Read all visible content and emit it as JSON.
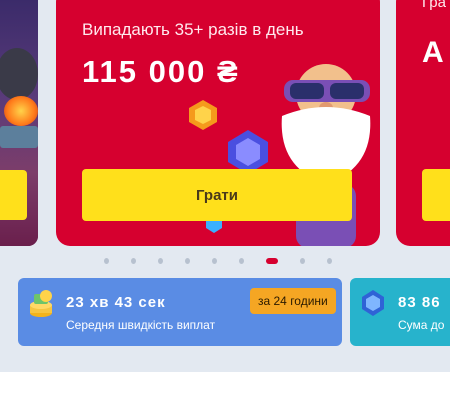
{
  "carousel": {
    "main_card": {
      "subtitle": "Випадають 35+ разів в день",
      "amount": "115 000 ₴",
      "play_label": "Грати"
    },
    "right_card": {
      "peek_top": "Гра",
      "peek_big": "A"
    },
    "dots_count": 9,
    "active_dot": 6
  },
  "stats": [
    {
      "value": "23 хв 43 сек",
      "label": "Середня швидкість виплат",
      "badge": "за 24 години",
      "icon": "coins-stack-icon",
      "color": "#5a8ce4"
    },
    {
      "value": "83 86",
      "label": "Сума до",
      "icon": "diamond-icon",
      "color": "#27b3cc"
    }
  ],
  "colors": {
    "brand_red": "#d6002f",
    "button_yellow": "#ffe01b",
    "badge_orange": "#f5a623"
  }
}
